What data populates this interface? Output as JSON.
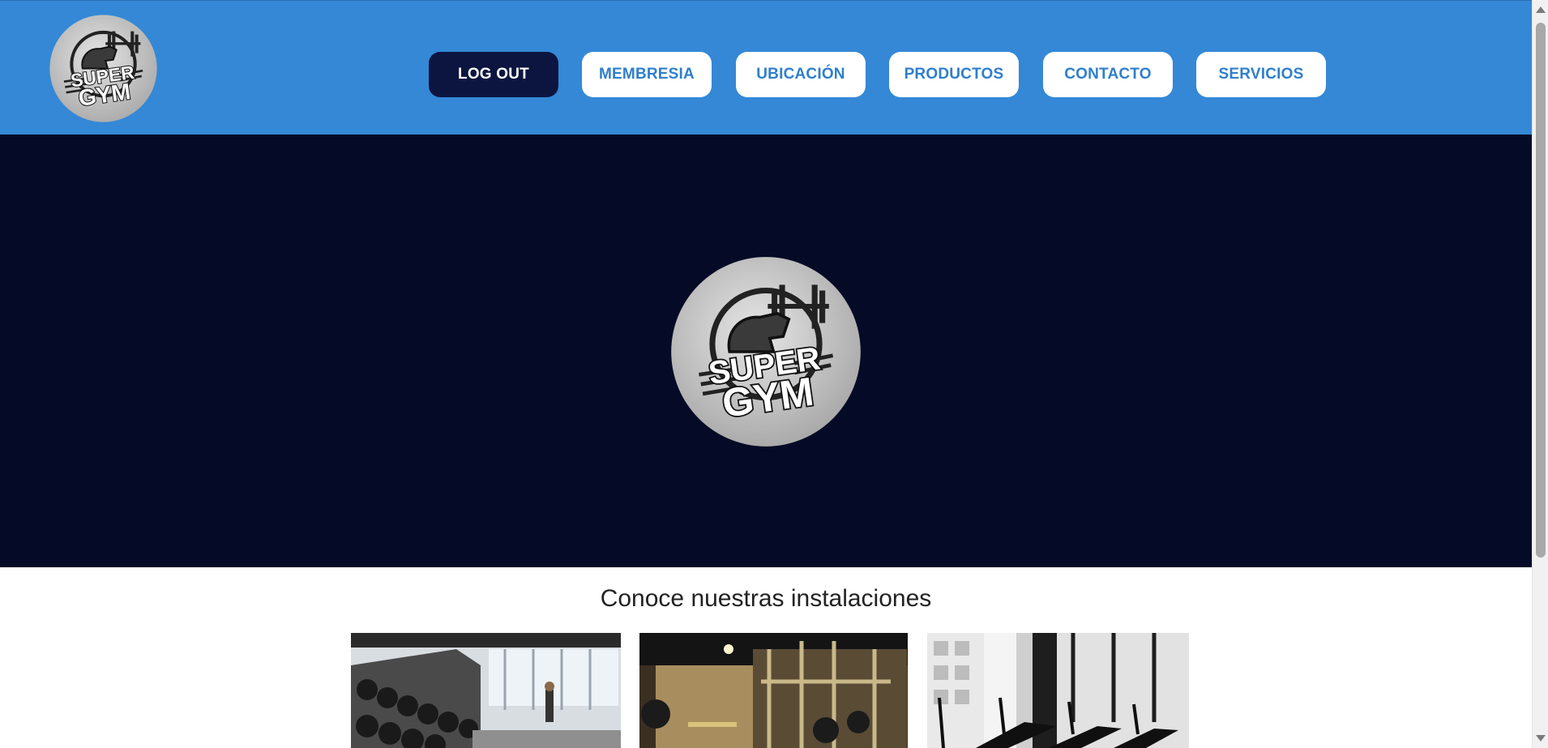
{
  "brand": {
    "logo_line1": "SUPER",
    "logo_line2": "GYM",
    "logo_icon": "flexing-arm-dumbbell-icon"
  },
  "nav": {
    "items": [
      {
        "label": "LOG OUT"
      },
      {
        "label": "MEMBRESIA"
      },
      {
        "label": "UBICACIÓN"
      },
      {
        "label": "PRODUCTOS"
      },
      {
        "label": "CONTACTO"
      },
      {
        "label": "SERVICIOS"
      }
    ]
  },
  "section": {
    "title": "Conoce nuestras instalaciones"
  },
  "colors": {
    "header_bg": "#3488d6",
    "hero_bg": "#050b26",
    "nav_active_bg": "#0b1540",
    "nav_text": "#2f7fcc"
  }
}
